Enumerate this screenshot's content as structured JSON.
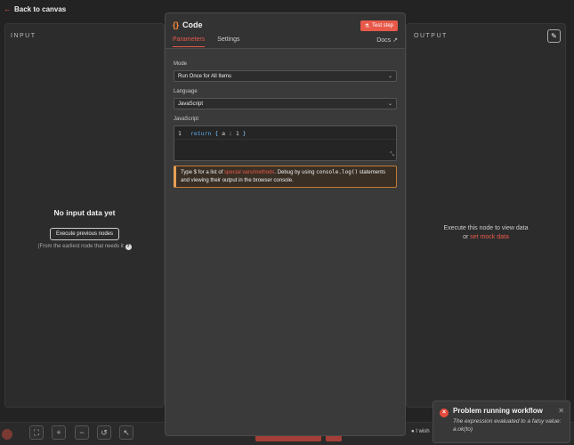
{
  "top_bar": {
    "back_label": "Back to canvas"
  },
  "input_panel": {
    "label": "INPUT",
    "empty_title": "No input data yet",
    "execute_button": "Execute previous nodes",
    "hint": "(From the earliest node that needs it"
  },
  "output_panel": {
    "label": "OUTPUT",
    "empty_text": "Execute this node to view data",
    "or_text": "or",
    "mock_link": "set mock data"
  },
  "node": {
    "title": "Code",
    "test_step": "Test step",
    "tabs": [
      "Parameters",
      "Settings"
    ],
    "active_tab": "Parameters",
    "docs_label": "Docs",
    "mode_label": "Mode",
    "mode_value": "Run Once for All Items",
    "language_label": "Language",
    "language_value": "JavaScript",
    "code_label": "JavaScript",
    "code": {
      "line_number": "1",
      "keyword": "return",
      "open": "{",
      "body": "a : 1",
      "close": "}"
    },
    "notice": {
      "pre": "Type $ for a list of",
      "link": "special vars/methods",
      "mid": ". Debug by using",
      "code": "console.log()",
      "post": "statements and viewing their output in the browser console."
    }
  },
  "bottom_bar": {
    "wish_text": "I wish"
  },
  "toast": {
    "title": "Problem running workflow",
    "message": "The expression evaluated to a falsy value: a.ok(to)"
  },
  "colors": {
    "accent": "#e8594a",
    "warning_border": "#e8a054",
    "error": "#e54a3b"
  }
}
